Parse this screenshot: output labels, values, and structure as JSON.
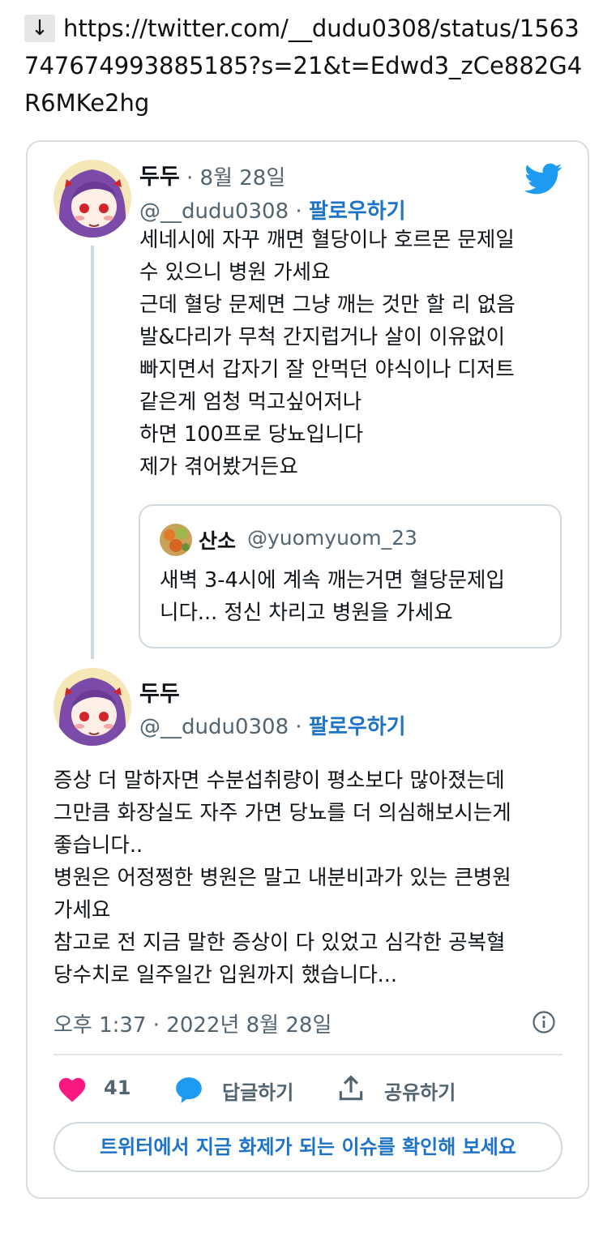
{
  "url": {
    "arrow": "↓",
    "text": "https://twitter.com/__dudu0308/status/1563747674993885185?s=21&t=Edwd3_zCe882G4R6MKe2hg"
  },
  "tweet1": {
    "name": "두두",
    "date": "· 8월 28일",
    "handle": "@__dudu0308",
    "follow": "팔로우하기",
    "dot": "·",
    "text": "세네시에 자꾸 깨면 혈당이나 호르몬 문제일\n수 있으니 병원 가세요\n근데 혈당 문제면 그냥 깨는 것만 할 리 없음\n발&다리가 무척 간지럽거나 살이 이유없이\n빠지면서 갑자기 잘 안먹던 야식이나 디저트\n같은게 엄청 먹고싶어저나\n하면 100프로 당뇨입니다\n제가 겪어봤거든요"
  },
  "quote": {
    "name": "산소",
    "handle": "@yuomyuom_23",
    "text": "새벽 3-4시에 계속 깨는거면 혈당문제입\n니다... 정신 차리고 병원을 가세요"
  },
  "tweet2": {
    "name": "두두",
    "handle": "@__dudu0308",
    "follow": "팔로우하기",
    "dot": "·",
    "text": "증상 더 말하자면 수분섭취량이 평소보다 많아졌는데\n그만큼 화장실도 자주 가면 당뇨를 더 의심해보시는게\n좋습니다..\n병원은 어정쩡한 병원은 말고 내분비과가 있는 큰병원\n가세요\n참고로 전 지금 말한 증상이 다 있었고 심각한 공복혈\n당수치로 일주일간 입원까지 했습니다...",
    "timestamp": "오후 1:37 · 2022년 8월 28일"
  },
  "actions": {
    "likes": "41",
    "reply": "답글하기",
    "share": "공유하기"
  },
  "trend_button": "트위터에서 지금 화제가 되는 이슈를 확인해 보세요",
  "colors": {
    "accent": "#1d9bf0",
    "link": "#1d73c8",
    "like": "#f91880",
    "muted": "#536471",
    "border": "#cfd9de"
  },
  "icons": [
    "twitter-bird-icon",
    "info-icon",
    "heart-icon",
    "reply-bubble-icon",
    "share-icon"
  ]
}
